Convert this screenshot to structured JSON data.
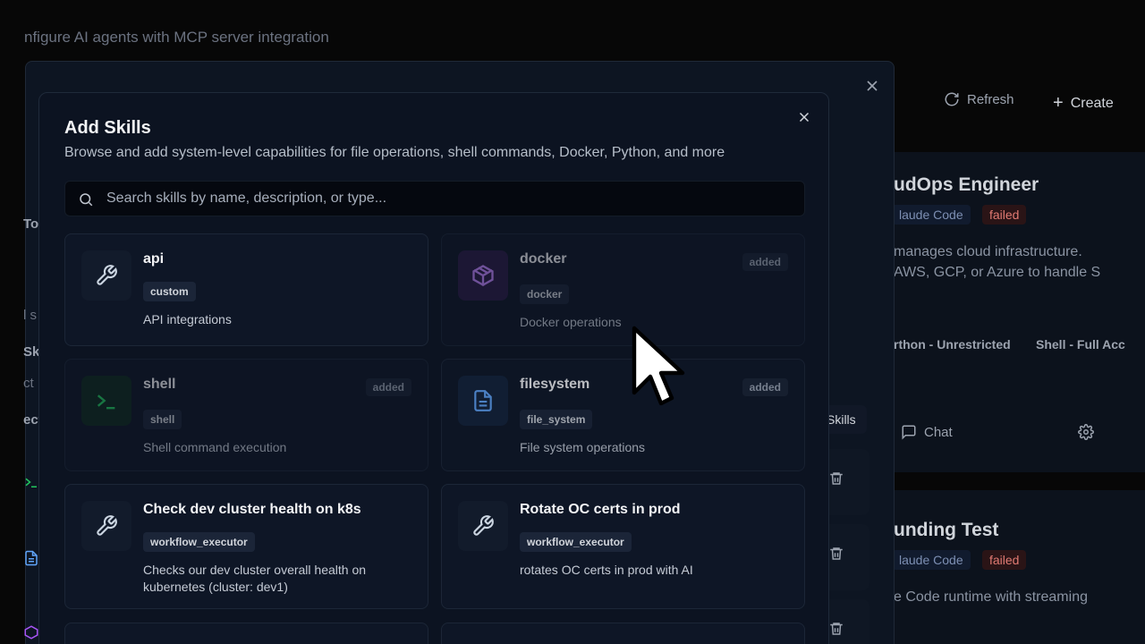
{
  "background": {
    "subtitle": "nfigure AI agents with MCP server integration",
    "refresh_label": "Refresh",
    "create_label": "Create",
    "left_fragments": [
      "To",
      "l s",
      "Sk",
      "ct",
      "ect"
    ],
    "right_cards": [
      {
        "title": "udOps Engineer",
        "runtime": "laude Code",
        "status": "failed",
        "desc_line1": "manages cloud infrastructure.",
        "desc_line2": "AWS, GCP, or Azure to handle S",
        "chip1": "rthon - Unrestricted",
        "chip2": "Shell - Full Acc",
        "chat_label": "Chat"
      },
      {
        "title": "unding Test",
        "runtime": "laude Code",
        "status": "failed",
        "desc_line1": "e Code runtime with streaming"
      }
    ],
    "skills_label": "Skills"
  },
  "dialog": {
    "title": "Add Skills",
    "subtitle": "Browse and add system-level capabilities for file operations, shell commands, Docker, Python, and more",
    "search_placeholder": "Search skills by name, description, or type...",
    "skills": [
      {
        "name": "api",
        "type": "custom",
        "description": "API integrations",
        "added": false,
        "icon": "wrench-icon"
      },
      {
        "name": "docker",
        "type": "docker",
        "description": "Docker operations",
        "added": true,
        "added_label": "added",
        "icon": "box-icon"
      },
      {
        "name": "shell",
        "type": "shell",
        "description": "Shell command execution",
        "added": true,
        "added_label": "added",
        "icon": "terminal-icon"
      },
      {
        "name": "filesystem",
        "type": "file_system",
        "description": "File system operations",
        "added": true,
        "added_label": "added",
        "icon": "file-icon"
      },
      {
        "name": "Check dev cluster health on k8s",
        "type": "workflow_executor",
        "description": "Checks our dev cluster overall health on kubernetes (cluster: dev1)",
        "added": false,
        "icon": "wrench-icon"
      },
      {
        "name": "Rotate OC certs in prod",
        "type": "workflow_executor",
        "description": "rotates OC certs in prod with AI",
        "added": false,
        "icon": "wrench-icon"
      }
    ]
  },
  "colors": {
    "accent_failed": "#e07a72",
    "accent_terminal": "#22c55e",
    "accent_docker": "#a855f7",
    "accent_file": "#60a5fa"
  }
}
